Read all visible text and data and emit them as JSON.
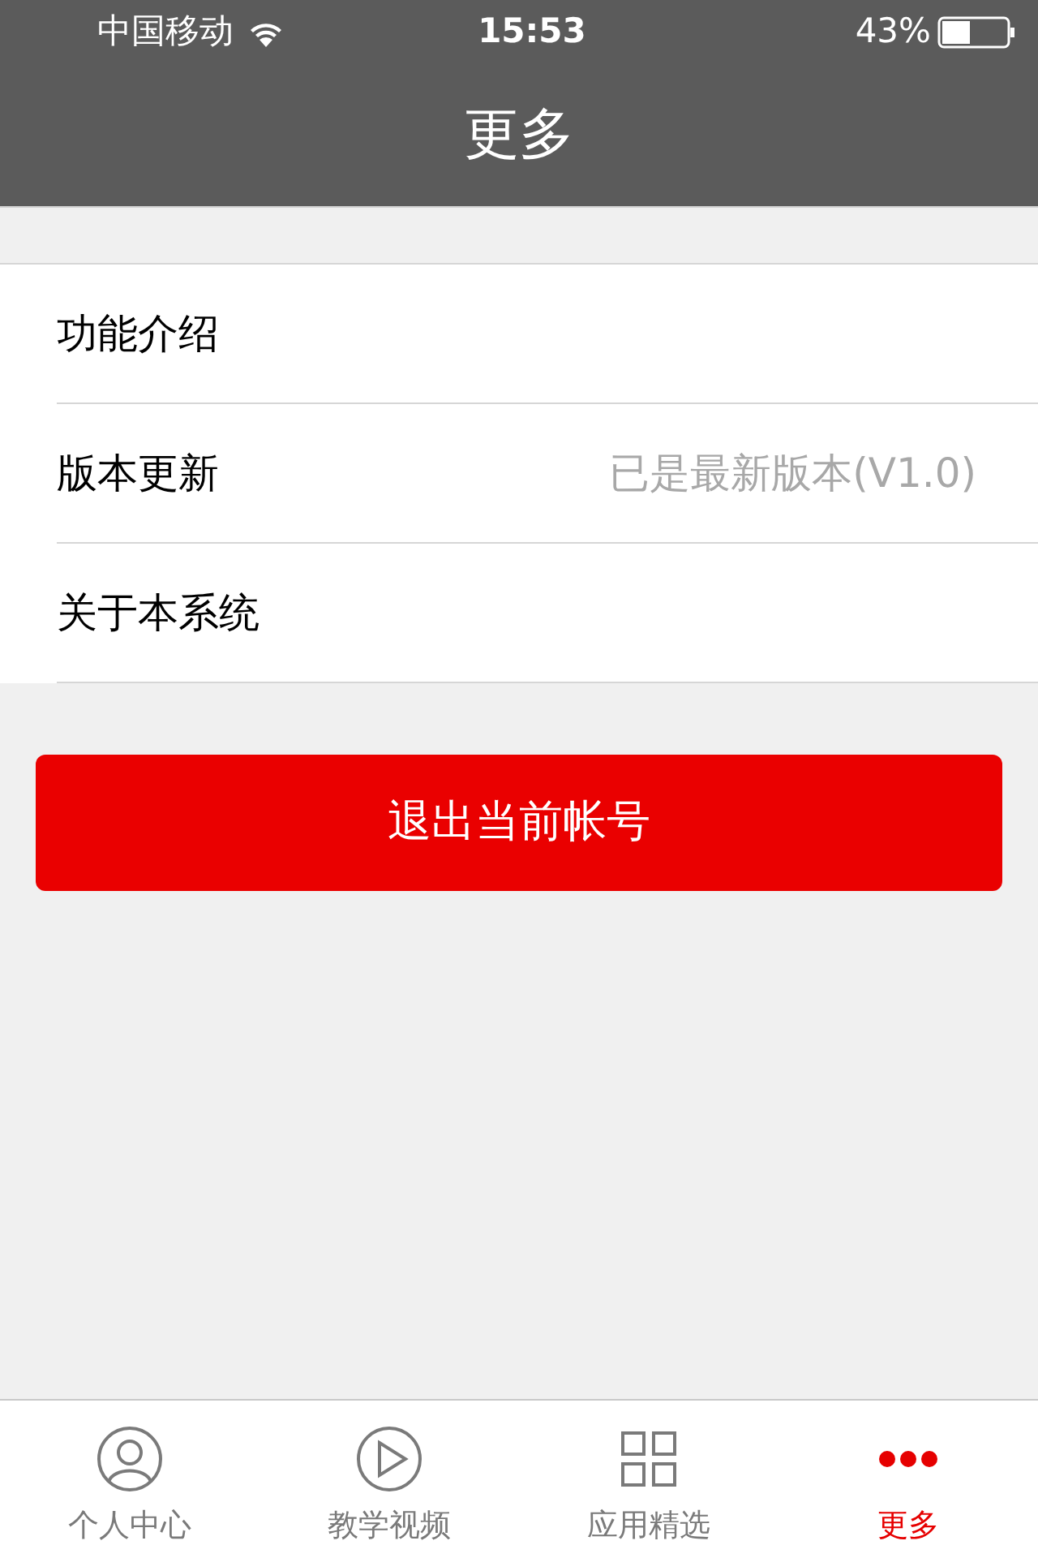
{
  "status_bar": {
    "carrier": "中国移动",
    "time": "15:53",
    "battery": "43%"
  },
  "nav_bar": {
    "title": "更多"
  },
  "menu": [
    {
      "label": "功能介绍"
    },
    {
      "label": "版本更新",
      "value": "已是最新版本(V1.0)"
    },
    {
      "label": "关于本系统"
    }
  ],
  "logout_button": "退出当前帐号",
  "tab_bar": [
    {
      "kind": "person",
      "label": "个人中心",
      "selected": false
    },
    {
      "kind": "play",
      "label": "教学视频",
      "selected": false
    },
    {
      "kind": "grid",
      "label": "应用精选",
      "selected": false
    },
    {
      "kind": "more",
      "label": "更多",
      "selected": true
    }
  ]
}
